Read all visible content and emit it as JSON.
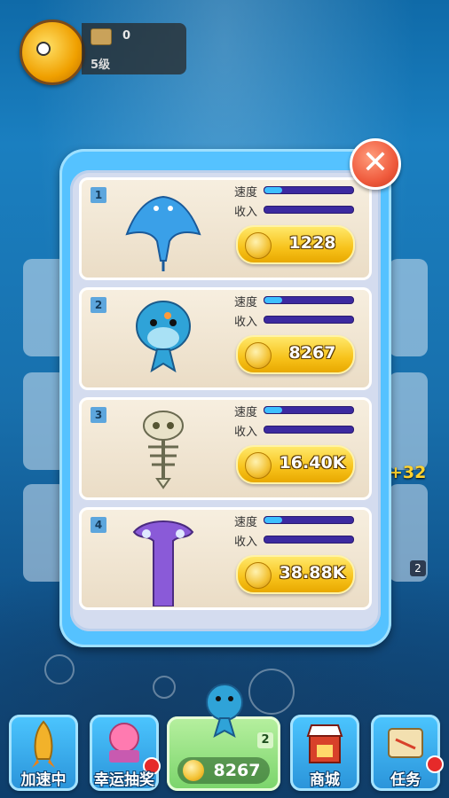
{
  "player": {
    "coins": "0",
    "level": "5级",
    "avatar_icon": "goldfish-avatar"
  },
  "background": {
    "bonus_text": "+32",
    "tank_badge": "2"
  },
  "modal": {
    "close_icon": "close-x-icon",
    "close_glyph": "✕",
    "stat_speed_label": "速度",
    "stat_income_label": "收入",
    "items": [
      {
        "index": "1",
        "name_icon": "manta-ray-icon",
        "speed": 0.2,
        "income": 0.0,
        "price": "1228"
      },
      {
        "index": "2",
        "name_icon": "whale-icon",
        "speed": 0.2,
        "income": 0.0,
        "price": "8267"
      },
      {
        "index": "3",
        "name_icon": "fish-skeleton-icon",
        "speed": 0.2,
        "income": 0.0,
        "price": "16.40K"
      },
      {
        "index": "4",
        "name_icon": "squid-icon",
        "speed": 0.2,
        "income": 0.0,
        "price": "38.88K"
      }
    ]
  },
  "bottom_bar": {
    "speed_up_label": "加速中",
    "lottery_label": "幸运抽奖",
    "buy_price": "8267",
    "buy_badge": "2",
    "shop_label": "商城",
    "tasks_label": "任务"
  },
  "colors": {
    "modal_blue": "#55c2ff",
    "bar_track": "#3c2aa0",
    "bar_fill": "#3ec0ff",
    "price_gold": "#f7c21a"
  }
}
